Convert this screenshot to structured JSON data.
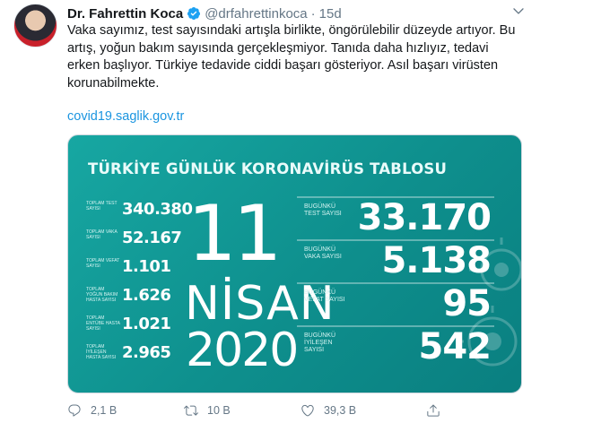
{
  "tweet": {
    "author": "Dr. Fahrettin Koca",
    "handle": "@drfahrettinkoca",
    "separator": "·",
    "time": "15d",
    "text_lines": [
      "Vaka sayımız, test sayısındaki artışla birlikte, öngörülebilir düzeyde artıyor. Bu",
      "artış, yoğun bakım sayısında gerçekleşmiyor. Tanıda daha hızlıyız, tedavi",
      "erken başlıyor. Türkiye tedavide ciddi başarı gösteriyor. Asıl başarı virüsten",
      "korunabilmekte."
    ],
    "link": "covid19.saglik.gov.tr"
  },
  "card": {
    "title": "TÜRKİYE GÜNLÜK KORONAVİRÜS TABLOSU",
    "date_day": "11",
    "date_month": "NİSAN",
    "date_year": "2020",
    "left_stats": [
      {
        "label": "TOPLAM TEST SAYISI",
        "value": "340.380"
      },
      {
        "label": "TOPLAM VAKA SAYISI",
        "value": "52.167"
      },
      {
        "label": "TOPLAM VEFAT SAYISI",
        "value": "1.101"
      },
      {
        "label": "TOPLAM YOĞUN BAKIM HASTA SAYISI",
        "value": "1.626"
      },
      {
        "label": "TOPLAM ENTÜBE HASTA SAYISI",
        "value": "1.021"
      },
      {
        "label": "TOPLAM İYİLEŞEN HASTA SAYISI",
        "value": "2.965"
      }
    ],
    "right_stats": [
      {
        "label": "BUGÜNKÜ TEST SAYISI",
        "value": "33.170"
      },
      {
        "label": "BUGÜNKÜ VAKA SAYISI",
        "value": "5.138"
      },
      {
        "label": "BUGÜNKÜ VEFAT SAYISI",
        "value": "95"
      },
      {
        "label": "BUGÜNKÜ İYİLEŞEN SAYISI",
        "value": "542"
      }
    ]
  },
  "actions": {
    "reply_count": "2,1 B",
    "retweet_count": "10 B",
    "like_count": "39,3 B"
  },
  "colors": {
    "accent": "#1b95e0",
    "card_bg": "#0e8f8d",
    "muted": "#657786"
  }
}
